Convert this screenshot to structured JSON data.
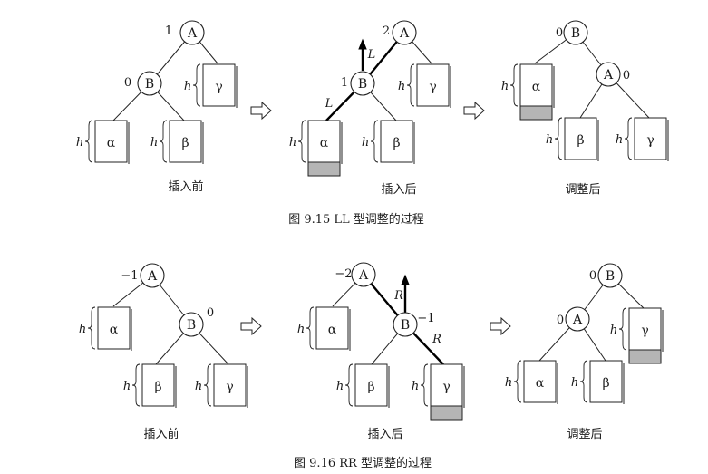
{
  "fig1": {
    "caption": "图 9.15   LL 型调整的过程",
    "panels": [
      {
        "label": "插入前",
        "nodes": [
          {
            "id": "A",
            "bf": "1"
          },
          {
            "id": "B",
            "bf": "0"
          }
        ],
        "subtrees": [
          {
            "sym": "α",
            "h": "h"
          },
          {
            "sym": "β",
            "h": "h"
          },
          {
            "sym": "γ",
            "h": "h"
          }
        ]
      },
      {
        "label": "插入后",
        "nodes": [
          {
            "id": "A",
            "bf": "2"
          },
          {
            "id": "B",
            "bf": "1"
          }
        ],
        "subtrees": [
          {
            "sym": "α",
            "h": "h"
          },
          {
            "sym": "β",
            "h": "h"
          },
          {
            "sym": "γ",
            "h": "h"
          }
        ],
        "path_labels": [
          "L",
          "L"
        ]
      },
      {
        "label": "调整后",
        "nodes": [
          {
            "id": "B",
            "bf": "0"
          },
          {
            "id": "A",
            "bf": "0"
          }
        ],
        "subtrees": [
          {
            "sym": "α",
            "h": "h"
          },
          {
            "sym": "β",
            "h": "h"
          },
          {
            "sym": "γ",
            "h": "h"
          }
        ]
      }
    ]
  },
  "fig2": {
    "caption": "图 9.16   RR 型调整的过程",
    "panels": [
      {
        "label": "插入前",
        "nodes": [
          {
            "id": "A",
            "bf": "−1"
          },
          {
            "id": "B",
            "bf": "0"
          }
        ],
        "subtrees": [
          {
            "sym": "α",
            "h": "h"
          },
          {
            "sym": "β",
            "h": "h"
          },
          {
            "sym": "γ",
            "h": "h"
          }
        ]
      },
      {
        "label": "插入后",
        "nodes": [
          {
            "id": "A",
            "bf": "−2"
          },
          {
            "id": "B",
            "bf": "−1"
          }
        ],
        "subtrees": [
          {
            "sym": "α",
            "h": "h"
          },
          {
            "sym": "β",
            "h": "h"
          },
          {
            "sym": "γ",
            "h": "h"
          }
        ],
        "path_labels": [
          "R",
          "R"
        ]
      },
      {
        "label": "调整后",
        "nodes": [
          {
            "id": "B",
            "bf": "0"
          },
          {
            "id": "A",
            "bf": "0"
          }
        ],
        "subtrees": [
          {
            "sym": "α",
            "h": "h"
          },
          {
            "sym": "β",
            "h": "h"
          },
          {
            "sym": "γ",
            "h": "h"
          }
        ]
      }
    ]
  }
}
